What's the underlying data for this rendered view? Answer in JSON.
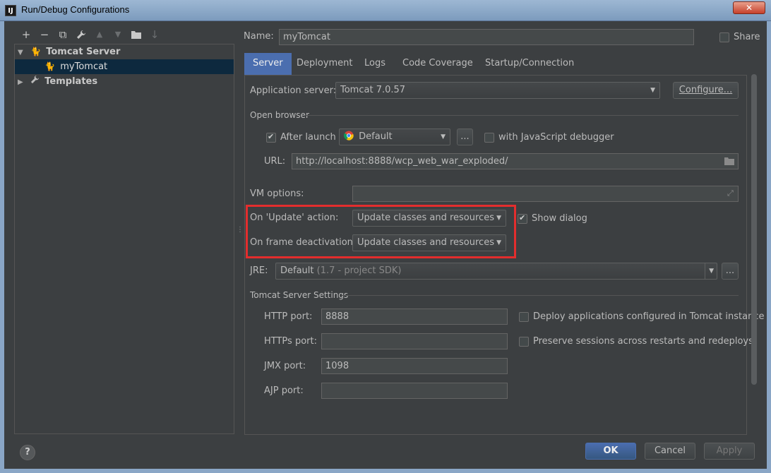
{
  "window": {
    "title": "Run/Debug Configurations",
    "app_icon": "IJ",
    "close_glyph": "✕"
  },
  "toolbar": {
    "add": "+",
    "remove": "−",
    "copy": "⧉",
    "edit": "🔧",
    "up": "▲",
    "down": "▼",
    "folder": "📁",
    "sort": "↓"
  },
  "tree": {
    "items": [
      {
        "label": "Tomcat Server",
        "expanded": true,
        "bold": true
      },
      {
        "label": "myTomcat",
        "selected": true
      },
      {
        "label": "Templates",
        "expanded": false,
        "bold": true
      }
    ]
  },
  "config": {
    "name_label": "Name:",
    "name_value": "myTomcat",
    "share_label": "Share"
  },
  "tabs": [
    "Server",
    "Deployment",
    "Logs",
    "Code Coverage",
    "Startup/Connection"
  ],
  "server": {
    "app_server_label": "Application server:",
    "app_server_value": "Tomcat 7.0.57",
    "configure_label": "Configure...",
    "open_browser_title": "Open browser",
    "after_launch_label": "After launch",
    "browser_value": "Default",
    "browse_ellipsis": "...",
    "js_debugger_label": "with JavaScript debugger",
    "url_label": "URL:",
    "url_value": "http://localhost:8888/wcp_web_war_exploded/",
    "vm_options_label": "VM options:",
    "on_update_label": "On 'Update' action:",
    "on_update_value": "Update classes and resources",
    "show_dialog_label": "Show dialog",
    "on_frame_label": "On frame deactivation:",
    "on_frame_value": "Update classes and resources",
    "jre_label": "JRE:",
    "jre_value": "Default",
    "jre_hint": "(1.7 - project SDK)",
    "jre_ellipsis": "...",
    "tomcat_settings_title": "Tomcat Server Settings",
    "http_port_label": "HTTP port:",
    "http_port_value": "8888",
    "https_port_label": "HTTPs port:",
    "https_port_value": "",
    "jmx_port_label": "JMX port:",
    "jmx_port_value": "1098",
    "ajp_port_label": "AJP port:",
    "ajp_port_value": "",
    "deploy_apps_label": "Deploy applications configured in Tomcat instance",
    "preserve_sessions_label": "Preserve sessions across restarts and redeploys"
  },
  "footer": {
    "help": "?",
    "ok": "OK",
    "cancel": "Cancel",
    "apply": "Apply"
  },
  "colors": {
    "accent": "#4b6eaf",
    "highlight": "#e32d2d",
    "background": "#3c3f41"
  }
}
